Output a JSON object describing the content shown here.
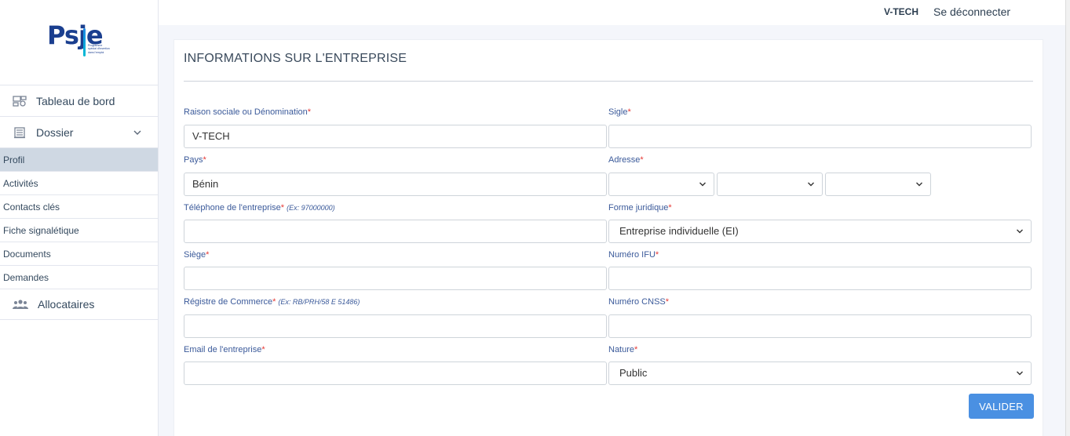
{
  "brand": {
    "name": "Psje",
    "tagline": "Programme spécial d'insertion dans l'emploi"
  },
  "topbar": {
    "user": "V-TECH",
    "logout": "Se déconnecter"
  },
  "sidebar": {
    "items": [
      {
        "label": "Tableau de bord",
        "icon": "dashboard-icon"
      },
      {
        "label": "Dossier",
        "icon": "folder-icon"
      },
      {
        "label": "Allocataires",
        "icon": "users-icon"
      }
    ],
    "sub_items": [
      "Profil",
      "Activités",
      "Contacts clés",
      "Fiche signalétique",
      "Documents",
      "Demandes"
    ],
    "active_sub_item": "Profil"
  },
  "form": {
    "title": "INFORMATIONS SUR L'ENTREPRISE",
    "required_mark": "*",
    "raison_sociale": {
      "label": "Raison sociale ou Dénomination",
      "value": "V-TECH"
    },
    "sigle": {
      "label": "Sigle",
      "value": ""
    },
    "pays": {
      "label": "Pays",
      "value": "Bénin"
    },
    "adresse": {
      "label": "Adresse",
      "select1": "",
      "select2": "",
      "select3": ""
    },
    "telephone": {
      "label": "Téléphone de l'entreprise",
      "hint": "(Ex: 97000000)",
      "value": ""
    },
    "forme_juridique": {
      "label": "Forme juridique",
      "value": "Entreprise individuelle (EI)"
    },
    "siege": {
      "label": "Siège",
      "value": ""
    },
    "ifu": {
      "label": "Numéro IFU",
      "value": ""
    },
    "registre": {
      "label": "Régistre de Commerce",
      "hint": "(Ex: RB/PRH/58 E 51486)",
      "value": ""
    },
    "cnss": {
      "label": "Numéro CNSS",
      "value": ""
    },
    "email": {
      "label": "Email de l'entreprise",
      "value": ""
    },
    "nature": {
      "label": "Nature",
      "value": "Public"
    },
    "submit": "VALIDER"
  },
  "colors": {
    "primary": "#4a90e2",
    "required": "#e53935",
    "label": "#3b5a9a",
    "active_bg": "#cfd8e3"
  }
}
